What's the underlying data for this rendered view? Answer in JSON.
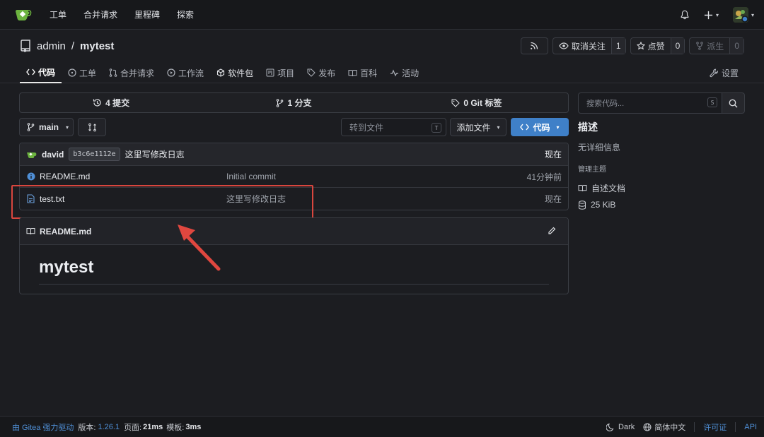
{
  "nav": {
    "links": [
      "工单",
      "合并请求",
      "里程碑",
      "探索"
    ],
    "plus_caret": "▾",
    "avatar_caret": "▾"
  },
  "repo": {
    "owner": "admin",
    "separator": "/",
    "name": "mytest",
    "unwatch_label": "取消关注",
    "unwatch_count": "1",
    "star_label": "点赞",
    "star_count": "0",
    "fork_label": "派生",
    "fork_count": "0"
  },
  "tabs": [
    {
      "label": "代码",
      "icon": "code-icon"
    },
    {
      "label": "工单",
      "icon": "issue-icon"
    },
    {
      "label": "合并请求",
      "icon": "pull-request-icon"
    },
    {
      "label": "工作流",
      "icon": "play-icon"
    },
    {
      "label": "软件包",
      "icon": "package-icon"
    },
    {
      "label": "项目",
      "icon": "project-icon"
    },
    {
      "label": "发布",
      "icon": "tag-icon"
    },
    {
      "label": "百科",
      "icon": "book-icon"
    },
    {
      "label": "活动",
      "icon": "pulse-icon"
    }
  ],
  "settings_label": "设置",
  "stats": {
    "commits": "4 提交",
    "branches": "1 分支",
    "tags": "0 Git 标签"
  },
  "toolbar": {
    "branch": "main",
    "goto_placeholder": "转到文件",
    "goto_kbd": "T",
    "add_file": "添加文件",
    "code_btn": "代码"
  },
  "last_commit": {
    "author": "david",
    "sha": "b3c6e1112e",
    "message": "这里写修改日志",
    "time": "现在"
  },
  "files": [
    {
      "name": "README.md",
      "message": "Initial commit",
      "time": "41分钟前",
      "icon": "info-icon"
    },
    {
      "name": "test.txt",
      "message": "这里写修改日志",
      "time": "现在",
      "icon": "file-icon"
    }
  ],
  "readme": {
    "filename": "README.md",
    "heading": "mytest"
  },
  "sidebar": {
    "search_placeholder": "搜索代码...",
    "search_kbd": "S",
    "desc_title": "描述",
    "desc_text": "无详细信息",
    "topics": "管理主题",
    "readme_link": "自述文档",
    "size": "25 KiB"
  },
  "footer": {
    "powered": "由 Gitea 强力驱动",
    "version_label": "版本:",
    "version": "1.26.1",
    "page_label": "页面:",
    "page_time": "21ms",
    "tpl_label": "模板:",
    "tpl_time": "3ms",
    "theme": "Dark",
    "language": "简体中文",
    "license": "许可证",
    "api": "API"
  },
  "colors": {
    "accent": "#3f80c8",
    "highlight": "#d9463e"
  }
}
